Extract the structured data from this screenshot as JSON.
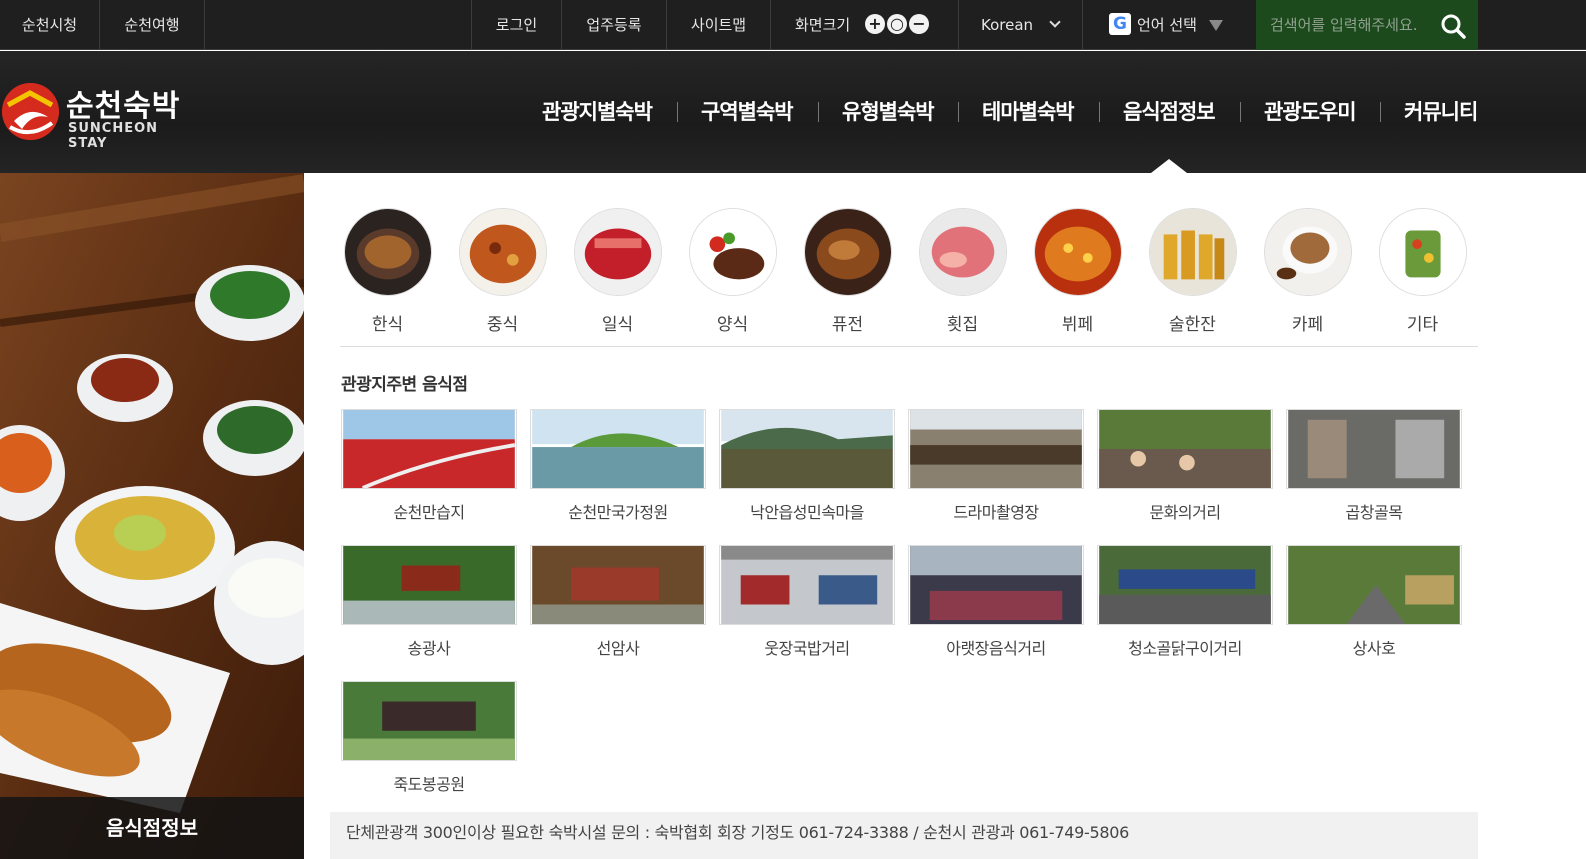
{
  "topbar": {
    "link_city": "순천시청",
    "link_travel": "순천여행",
    "login": "로그인",
    "register": "업주등록",
    "sitemap": "사이트맵",
    "zoom_label": "화면크기",
    "zoom_in": "+",
    "zoom_reset": "○",
    "zoom_out": "−",
    "language": "Korean",
    "translate_label": "언어 선택",
    "search_placeholder": "검색어를 입력해주세요."
  },
  "logo": {
    "korean": "순천숙박",
    "english": "SUNCHEON STAY"
  },
  "gnb": [
    "관광지별숙박",
    "구역별숙박",
    "유형별숙박",
    "테마별숙박",
    "음식점정보",
    "관광도우미",
    "커뮤니티"
  ],
  "side_title": "음식점정보",
  "categories": [
    "한식",
    "중식",
    "일식",
    "양식",
    "퓨전",
    "횟집",
    "뷔페",
    "술한잔",
    "카페",
    "기타"
  ],
  "section_title": "관광지주변 음식점",
  "spots": [
    "순천만습지",
    "순천만국가정원",
    "낙안읍성민속마을",
    "드라마촬영장",
    "문화의거리",
    "곱창골목",
    "송광사",
    "선암사",
    "웃장국밥거리",
    "아랫장음식거리",
    "청소골닭구이거리",
    "상사호",
    "죽도봉공원"
  ],
  "notice": "단체관광객 300인이상 필요한 숙박시설 문의 : 숙박협회 회장 기정도 061-724-3388 / 순천시 관광과 061-749-5806",
  "colors": {
    "topbar": "#1f1f1f",
    "search_bg": "#1c4a1c",
    "logo_red": "#d52b1e"
  }
}
